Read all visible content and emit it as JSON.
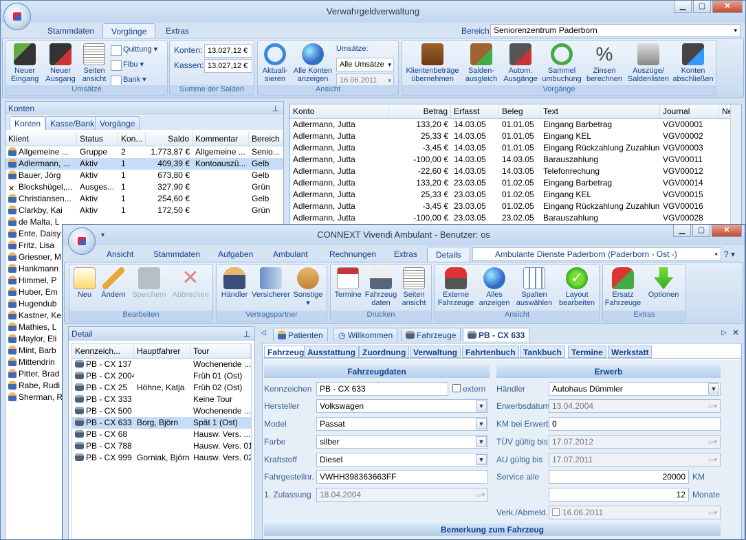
{
  "main": {
    "title": "Verwahrgeldverwaltung",
    "tabs": [
      "Stammdaten",
      "Vorgänge",
      "Extras"
    ],
    "bereich_label": "Bereich",
    "bereich_value": "Seniorenzentrum Paderborn",
    "groups": {
      "umsaetze": {
        "label": "Umsätze",
        "neuer_eingang": "Neuer Eingang",
        "neuer_ausgang": "Neuer Ausgang",
        "seiten_ansicht": "Seiten ansicht",
        "quittung": "Quittung",
        "fibu": "Fibu",
        "bank": "Bank"
      },
      "salden": {
        "label": "Summe der Salden",
        "konten_label": "Konten:",
        "konten_value": "13.027,12 €",
        "kassen_label": "Kassen:",
        "kassen_value": "13.027,12 €"
      },
      "ansicht": {
        "label": "Ansicht",
        "aktualisieren": "Aktuali- sieren",
        "alle_konten": "Alle Konten anzeigen",
        "umsaetze_label": "Umsätze:",
        "umsaetze_value": "Alle Umsätze",
        "date_value": "16.06.2011"
      },
      "vorgaenge": {
        "label": "Vorgänge",
        "buttons": [
          "Klientenbeträge übernehmen",
          "Salden- ausgleich",
          "Autom. Ausgänge",
          "Sammel umbuchung",
          "Zinsen berechnen",
          "Auszüge/ Saldenlisten",
          "Konten abschließen"
        ]
      }
    },
    "konten_panel": {
      "title": "Konten",
      "tabs": [
        "Konten",
        "Kasse/Bank",
        "Vorgänge"
      ],
      "columns": [
        "Klient",
        "Status",
        "Kon...",
        "Saldo",
        "Kommentar",
        "Bereich"
      ],
      "rows": [
        [
          "Allgemeine ...",
          "Gruppe",
          "2",
          "1.773,87 €",
          "Allgemeine ...",
          "Senio..."
        ],
        [
          "Adlermann, ...",
          "Aktiv",
          "1",
          "409,39 €",
          "Kontoauszü...",
          "Gelb"
        ],
        [
          "Bauer, Jörg",
          "Aktiv",
          "1",
          "673,80 €",
          "",
          "Gelb"
        ],
        [
          "Blockshügel,...",
          "Ausges...",
          "1",
          "327,90 €",
          "",
          "Grün"
        ],
        [
          "Christiansen...",
          "Aktiv",
          "1",
          "254,60 €",
          "",
          "Gelb"
        ],
        [
          "Clarkby, Kai",
          "Aktiv",
          "1",
          "172,50 €",
          "",
          "Grün"
        ]
      ],
      "more_names": [
        "de Malta, L",
        "Ente, Daisy",
        "Fritz, Lisa",
        "Griesner, M",
        "Hankmann",
        "Himmel, P",
        "Huber, Em",
        "Hugendub",
        "Kastner, Ke",
        "Mathies, L",
        "Maylor, Eli",
        "Mint, Barb",
        "Mittendrin",
        "Pitter, Brad",
        "Rabe, Rudi",
        "Sherman, R"
      ]
    },
    "journal": {
      "columns": [
        "Konto",
        "Betrag",
        "Erfasst",
        "Beleg",
        "Text",
        "Journal",
        "Ne"
      ],
      "rows": [
        [
          "Adlermann, Jutta",
          "133,20 €",
          "14.03.05",
          "01.01.05",
          "Eingang Barbetrag",
          "VGV00001"
        ],
        [
          "Adlermann, Jutta",
          "25,33 €",
          "14.03.05",
          "01.01.05",
          "Eingang KEL",
          "VGV00002"
        ],
        [
          "Adlermann, Jutta",
          "-3,45 €",
          "14.03.05",
          "01.01.05",
          "Eingang Rückzahlung Zuzahlung",
          "VGV00003"
        ],
        [
          "Adlermann, Jutta",
          "-100,00 €",
          "14.03.05",
          "14.03.05",
          "Barauszahlung",
          "VGV00011"
        ],
        [
          "Adlermann, Jutta",
          "-22,60 €",
          "14.03.05",
          "14.03.05",
          "Telefonrechung",
          "VGV00012"
        ],
        [
          "Adlermann, Jutta",
          "133,20 €",
          "23.03.05",
          "01.02.05",
          "Eingang Barbetrag",
          "VGV00014"
        ],
        [
          "Adlermann, Jutta",
          "25,33 €",
          "23.03.05",
          "01.02.05",
          "Eingang KEL",
          "VGV00015"
        ],
        [
          "Adlermann, Jutta",
          "-3,45 €",
          "23.03.05",
          "01.02.05",
          "Eingang Rückzahlung Zuzahlung",
          "VGV00016"
        ],
        [
          "Adlermann, Jutta",
          "-100,00 €",
          "23.03.05",
          "23.02.05",
          "Barauszahlung",
          "VGV00028"
        ]
      ]
    }
  },
  "connext": {
    "title": "CONNEXT Vivendi Ambulant - Benutzer: os",
    "tabs": [
      "Ansicht",
      "Stammdaten",
      "Aufgaben",
      "Ambulant",
      "Rechnungen",
      "Extras",
      "Details"
    ],
    "bereich_value": "Ambulante Dienste Paderborn (Paderborn - Ost -)",
    "help": "?",
    "groups": {
      "bearbeiten": {
        "label": "Bearbeiten",
        "buttons": [
          "Neu",
          "Ändern",
          "Speichern",
          "Abbrechen"
        ]
      },
      "vertragspartner": {
        "label": "Vertragspartner",
        "buttons": [
          "Händler",
          "Versicherer",
          "Sonstige"
        ]
      },
      "drucken": {
        "label": "Drucken",
        "buttons": [
          "Termine",
          "Fahrzeug daten",
          "Seiten ansicht"
        ]
      },
      "ansicht": {
        "label": "Ansicht",
        "buttons": [
          "Externe Fahrzeuge",
          "Alles anzeigen",
          "Spalten auswählen",
          "Layout bearbeiten"
        ]
      },
      "extras": {
        "label": "Extras",
        "buttons": [
          "Ersatz Fahrzeuge",
          "Optionen"
        ]
      }
    },
    "detail_panel": {
      "title": "Detail",
      "columns": [
        "Kennzeich...",
        "Hauptfahrer",
        "Tour"
      ],
      "rows": [
        [
          "PB - CX 137",
          "",
          "Wochenende ..."
        ],
        [
          "PB - CX 2004",
          "",
          "Früh 01 (Ost)"
        ],
        [
          "PB - CX 25",
          "Höhne, Katja",
          "Früh 02 (Ost)"
        ],
        [
          "PB - CX 333",
          "",
          "Keine Tour"
        ],
        [
          "PB - CX 500",
          "",
          "Wochenende ..."
        ],
        [
          "PB - CX 633",
          "Borg, Björn",
          "Spät 1 (Ost)"
        ],
        [
          "PB - CX 68",
          "",
          "Hausw. Vers. ..."
        ],
        [
          "PB - CX 788",
          "",
          "Hausw. Vers. 01"
        ],
        [
          "PB - CX 999",
          "Gorniak, Björn",
          "Hausw. Vers. 02"
        ]
      ]
    },
    "doc_tabs": [
      "Patienten",
      "Willkommen",
      "Fahrzeuge",
      "PB - CX 633"
    ],
    "sub_tabs": [
      "Fahrzeug",
      "Ausstattung",
      "Zuordnung",
      "Verwaltung",
      "Fahrtenbuch",
      "Tankbuch",
      "Termine",
      "Werkstatt"
    ],
    "form": {
      "section_left": "Fahrzeugdaten",
      "section_right": "Erwerb",
      "section_bottom": "Bemerkung zum Fahrzeug",
      "kennzeichen_label": "Kennzeichen",
      "kennzeichen": "PB - CX 633",
      "extern_label": "extern",
      "hersteller_label": "Hersteller",
      "hersteller": "Volkswagen",
      "model_label": "Model",
      "model": "Passat",
      "farbe_label": "Farbe",
      "farbe": "silber",
      "kraftstoff_label": "Kraftstoff",
      "kraftstoff": "Diesel",
      "fahrgestell_label": "Fahrgestellnr.",
      "fahrgestell": "VWHH398363663FF",
      "zulassung_label": "1. Zulassung",
      "zulassung": "18.04.2004",
      "haendler_label": "Händler",
      "haendler": "Autohaus Dümmler",
      "erwerbsdatum_label": "Erwerbsdatum",
      "erwerbsdatum": "13.04.2004",
      "km_label": "KM bei Erwerb",
      "km": "0",
      "tuev_label": "TÜV gültig bis",
      "tuev": "17.07.2012",
      "au_label": "AU gültig bis",
      "au": "17.07.2011",
      "service_label": "Service alle",
      "service_km": "20000",
      "service_km_unit": "KM",
      "service_monate": "12",
      "service_monate_unit": "Monate",
      "verk_label": "Verk./Abmeld.",
      "verk": "16.06.2011"
    }
  },
  "colors": {
    "accent": "#15428b",
    "selection": "#c6dcf7"
  }
}
